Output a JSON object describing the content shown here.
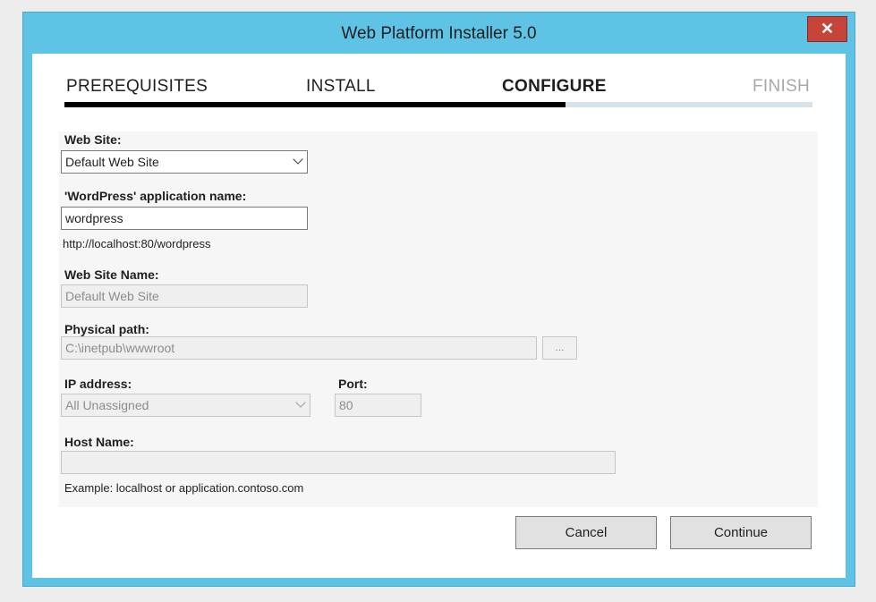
{
  "window": {
    "title": "Web Platform Installer 5.0",
    "close_label": "✕"
  },
  "steps": [
    {
      "label": "PREREQUISITES",
      "state": "done"
    },
    {
      "label": "INSTALL",
      "state": "done"
    },
    {
      "label": "CONFIGURE",
      "state": "current"
    },
    {
      "label": "FINISH",
      "state": "pending"
    }
  ],
  "progress": {
    "fraction": 0.67
  },
  "form": {
    "web_site": {
      "label": "Web Site:",
      "value": "Default Web Site"
    },
    "app_name": {
      "label": "'WordPress' application name:",
      "value": "wordpress",
      "url_hint": "http://localhost:80/wordpress"
    },
    "site_name": {
      "label": "Web Site Name:",
      "value": "Default Web Site"
    },
    "physical_path": {
      "label": "Physical path:",
      "value": "C:\\inetpub\\wwwroot",
      "browse_label": "..."
    },
    "ip_address": {
      "label": "IP address:",
      "value": "All Unassigned"
    },
    "port": {
      "label": "Port:",
      "value": "80"
    },
    "host_name": {
      "label": "Host Name:",
      "value": "",
      "example": "Example: localhost or application.contoso.com"
    }
  },
  "buttons": {
    "cancel": "Cancel",
    "continue": "Continue"
  }
}
